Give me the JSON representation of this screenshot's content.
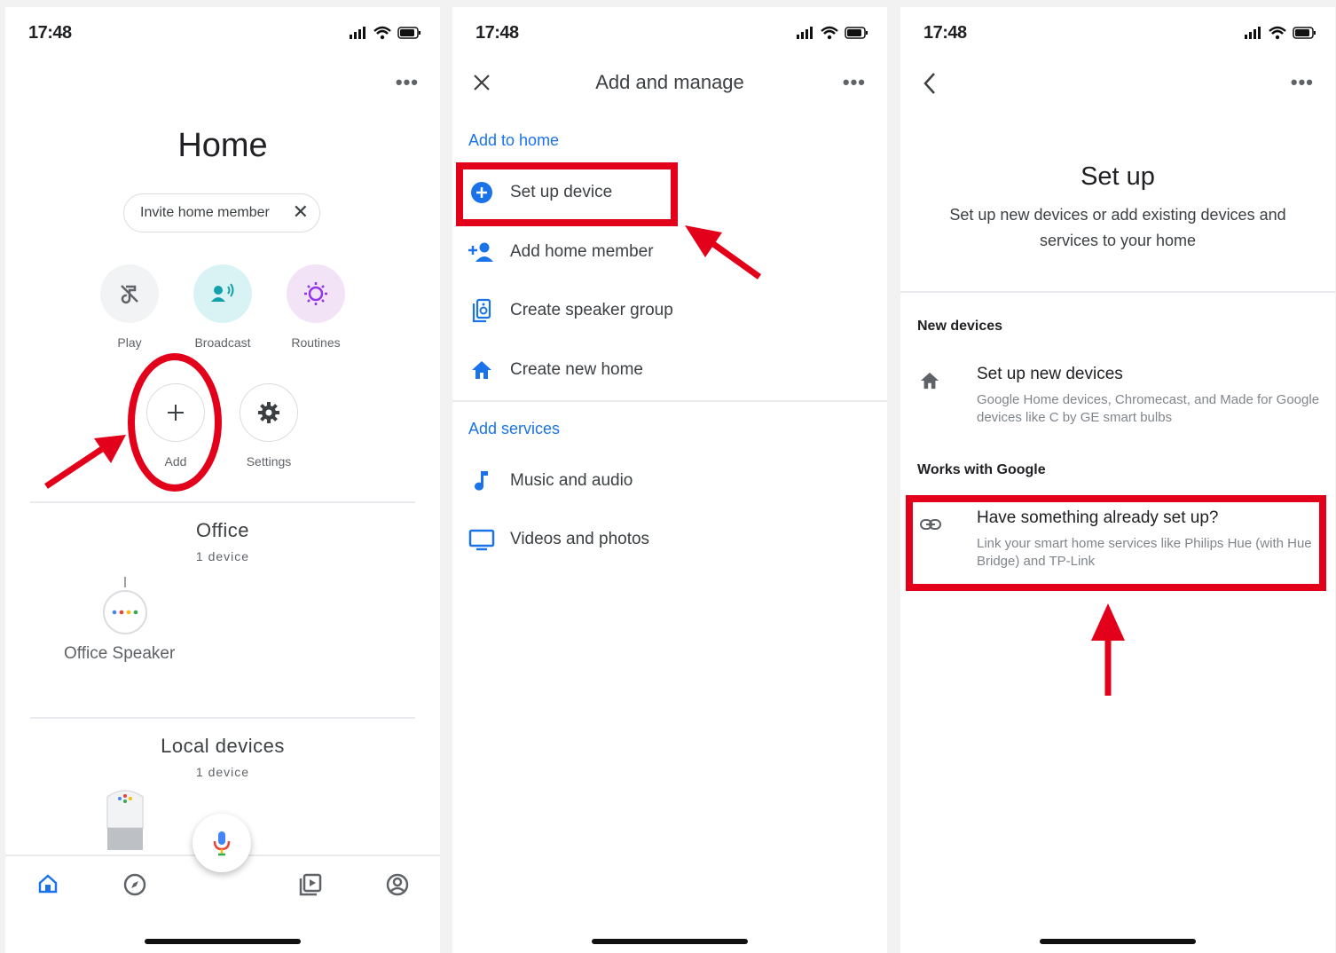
{
  "status": {
    "time": "17:48"
  },
  "colors": {
    "accent": "#1a73e8",
    "highlight": "#e3001b",
    "text": "#202124",
    "muted": "#5f6368"
  },
  "screen1": {
    "title": "Home",
    "invite_chip": {
      "label": "Invite home member"
    },
    "actions": [
      {
        "label": "Play",
        "icon": "music-off-icon"
      },
      {
        "label": "Broadcast",
        "icon": "broadcast-icon"
      },
      {
        "label": "Routines",
        "icon": "routines-icon"
      },
      {
        "label": "Add",
        "icon": "plus-icon"
      },
      {
        "label": "Settings",
        "icon": "gear-icon"
      }
    ],
    "rooms": [
      {
        "name": "Office",
        "count": "1 device",
        "devices": [
          {
            "name": "Office Speaker"
          }
        ]
      },
      {
        "name": "Local devices",
        "count": "1 device"
      }
    ],
    "nav": [
      "home-icon",
      "explore-icon",
      "media-icon",
      "account-icon"
    ]
  },
  "screen2": {
    "title": "Add and manage",
    "add_to_home": {
      "label": "Add to home",
      "items": [
        {
          "label": "Set up device",
          "icon": "add-circle-icon"
        },
        {
          "label": "Add home member",
          "icon": "person-add-icon"
        },
        {
          "label": "Create speaker group",
          "icon": "speaker-group-icon"
        },
        {
          "label": "Create new home",
          "icon": "house-icon"
        }
      ]
    },
    "add_services": {
      "label": "Add services",
      "items": [
        {
          "label": "Music and audio",
          "icon": "music-note-icon"
        },
        {
          "label": "Videos and photos",
          "icon": "tv-icon"
        }
      ]
    }
  },
  "screen3": {
    "title": "Set up",
    "description": "Set up new devices or add existing devices and services to your home",
    "new_devices": {
      "label": "New devices",
      "item": {
        "title": "Set up new devices",
        "desc": "Google Home devices, Chromecast, and Made for Google devices like C by GE smart bulbs"
      }
    },
    "works_with_google": {
      "label": "Works with Google",
      "item": {
        "title": "Have something already set up?",
        "desc": "Link your smart home services like Philips Hue (with Hue Bridge) and TP-Link"
      }
    }
  }
}
